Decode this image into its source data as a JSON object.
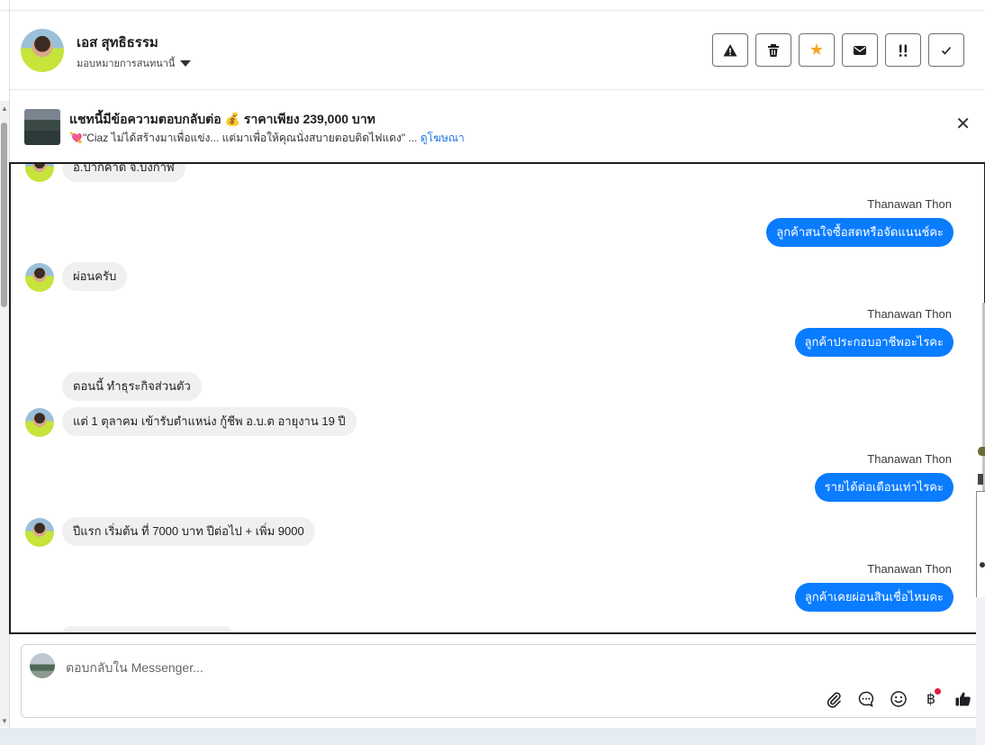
{
  "header": {
    "contact_name": "เอส สุทธิธรรม",
    "assign_label": "มอบหมายการสนทนานี้"
  },
  "toolbar": {
    "buttons": [
      {
        "name": "warning-icon",
        "label": "▲"
      },
      {
        "name": "trash-icon",
        "label": "🗑"
      },
      {
        "name": "star-icon",
        "label": "★"
      },
      {
        "name": "mail-icon",
        "label": "✉"
      },
      {
        "name": "priority-icon",
        "label": "!!"
      },
      {
        "name": "check-icon",
        "label": "✓"
      }
    ]
  },
  "ad_banner": {
    "title": "แชทนี้มีข้อความตอบกลับต่อ 💰 ราคาเพียง 239,000 บาท",
    "description": "💘\"Ciaz ไม่ได้สร้างมาเพื่อแข่ง... แต่มาเพื่อให้คุณนั่งสบายตอบติดไฟแดง\" ...",
    "link": "ดูโฆษณา",
    "close": "✕"
  },
  "thread": {
    "messages": [
      {
        "dir": "in",
        "text": "อ.ปากคาด จ.บึงกาฬ"
      },
      {
        "dir": "out",
        "sender": "Thanawan Thon",
        "text": "ลูกค้าสนใจซื้อสดหรือจัดแนนช์คะ"
      },
      {
        "dir": "in",
        "text": "ผ่อนครับ"
      },
      {
        "dir": "out",
        "sender": "Thanawan Thon",
        "text": "ลูกค้าประกอบอาชีพอะไรคะ"
      },
      {
        "dir": "in",
        "text": "ตอนนี้ ทำธุระกิจส่วนตัว"
      },
      {
        "dir": "in",
        "text": "แต่ 1 ตุลาคม เข้ารับตำแหน่ง กู้ชีพ อ.บ.ต อายุงาน 19 ปี"
      },
      {
        "dir": "out",
        "sender": "Thanawan Thon",
        "text": "รายได้ต่อเดือนเท่าไรคะ"
      },
      {
        "dir": "in",
        "text": "ปีแรก เริ่มต้น ที่ 7000 บาท ปีต่อไป + เพิ่ม 9000"
      },
      {
        "dir": "out",
        "sender": "Thanawan Thon",
        "text": "ลูกค้าเคยผ่อนสินเชื่อไหมคะ"
      }
    ]
  },
  "composer": {
    "placeholder": "ตอบกลับใน Messenger...",
    "icons": [
      "attachment-icon",
      "saved-reply-icon",
      "emoji-icon",
      "baht-payment-icon",
      "thumbs-up-icon"
    ],
    "baht_symbol": "฿"
  },
  "colors": {
    "outgoing_bubble": "#0a7cff",
    "incoming_bubble": "#f0f0f0",
    "star": "#f5a623",
    "link": "#1b74e4",
    "notification_dot": "#e41e3f"
  }
}
